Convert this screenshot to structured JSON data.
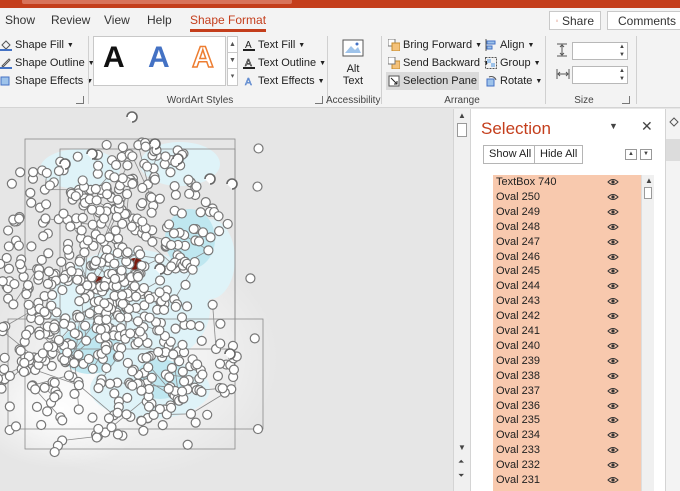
{
  "tabs": [
    {
      "label": "Show",
      "active": false
    },
    {
      "label": "Review",
      "active": false
    },
    {
      "label": "View",
      "active": false
    },
    {
      "label": "Help",
      "active": false
    },
    {
      "label": "Shape Format",
      "active": true
    }
  ],
  "share_label": "Share",
  "comments_label": "Comments",
  "ribbon": {
    "shape_styles": {
      "fill": "Shape Fill",
      "outline": "Shape Outline",
      "effects": "Shape Effects"
    },
    "wordart": {
      "letters": [
        "A",
        "A",
        "A"
      ],
      "text_fill": "Text Fill",
      "text_outline": "Text Outline",
      "text_effects": "Text Effects",
      "label": "WordArt Styles"
    },
    "accessibility": {
      "alt_text_line1": "Alt",
      "alt_text_line2": "Text",
      "label": "Accessibility"
    },
    "arrange": {
      "bring_forward": "Bring Forward",
      "send_backward": "Send Backward",
      "selection_pane": "Selection Pane",
      "align": "Align",
      "group": "Group",
      "rotate": "Rotate",
      "label": "Arrange"
    },
    "size": {
      "height_value": "",
      "width_value": "",
      "label": "Size"
    }
  },
  "pane": {
    "title": "Selection",
    "show_all": "Show All",
    "hide_all": "Hide All",
    "items": [
      "TextBox 740",
      "Oval 250",
      "Oval 249",
      "Oval 248",
      "Oval 247",
      "Oval 246",
      "Oval 245",
      "Oval 244",
      "Oval 243",
      "Oval 242",
      "Oval 241",
      "Oval 240",
      "Oval 239",
      "Oval 238",
      "Oval 237",
      "Oval 236",
      "Oval 235",
      "Oval 234",
      "Oval 233",
      "Oval 232",
      "Oval 231"
    ]
  },
  "colors": {
    "accent": "#c43e1c",
    "selected_row": "#f8c9ae"
  }
}
